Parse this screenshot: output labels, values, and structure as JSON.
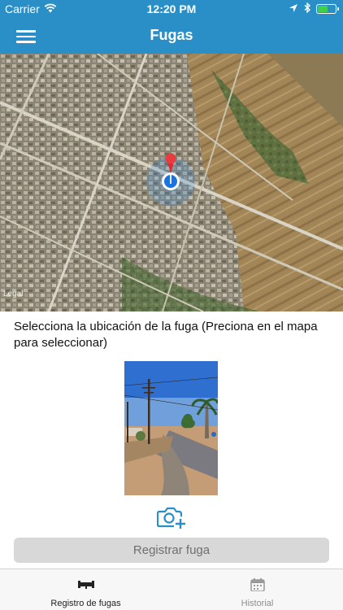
{
  "status_bar": {
    "carrier": "Carrier",
    "time": "12:20 PM",
    "wifi_icon": "wifi-icon",
    "location_icon": "location-arrow-icon",
    "battery_level": 0.5,
    "battery_color": "#3ed04a"
  },
  "nav": {
    "title": "Fugas",
    "menu_icon": "hamburger-menu-icon",
    "color": "#2a8fc7"
  },
  "map": {
    "legal_label": "Legal",
    "pin_icon": "map-pin-icon",
    "user_location_icon": "user-location-icon"
  },
  "form": {
    "instruction": "Selecciona la ubicación de la fuga (Preciona en el mapa para seleccionar)",
    "camera_icon": "camera-add-icon",
    "register_label": "Registrar fuga"
  },
  "tabs": [
    {
      "label": "Registro de fugas",
      "icon": "pipe-icon",
      "active": true
    },
    {
      "label": "Historial",
      "icon": "calendar-icon",
      "active": false
    }
  ]
}
